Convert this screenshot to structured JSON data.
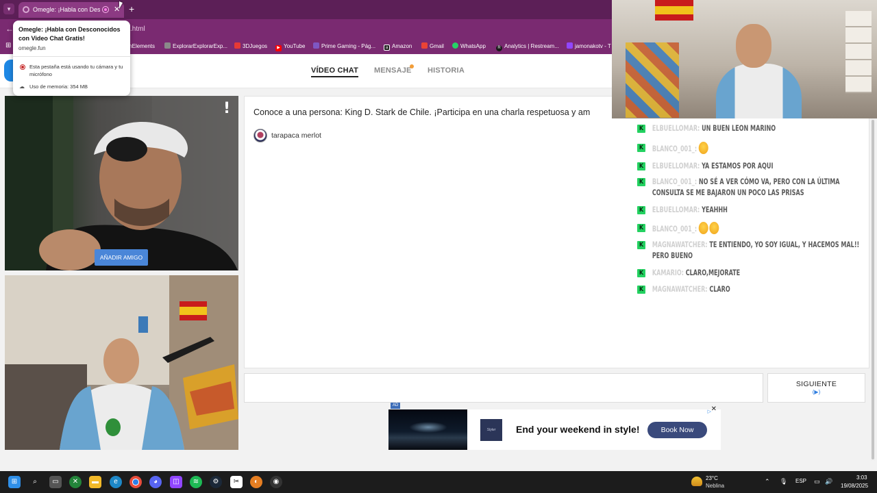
{
  "browser": {
    "tab_title": "Omegle: ¡Habla con Desconocidos con Video Chat Gratis!",
    "new_tab": "+",
    "tab_close": "✕",
    "url": ".html",
    "bookmarks": [
      {
        "label": "mElements",
        "color": "#7b6cff"
      },
      {
        "label": "ExplorarExplorarExp...",
        "color": "#8a8a8a"
      },
      {
        "label": "3DJuegos",
        "color": "#e53935"
      },
      {
        "label": "YouTube",
        "color": "#ff0000"
      },
      {
        "label": "Prime Gaming - Pág...",
        "color": "#7e57c2"
      },
      {
        "label": "Amazon",
        "color": "#222222"
      },
      {
        "label": "Gmail",
        "color": "#ea4335"
      },
      {
        "label": "WhatsApp",
        "color": "#25d366"
      },
      {
        "label": "Analytics | Restream...",
        "color": "#1a1a1a"
      },
      {
        "label": "jamonakotv - T",
        "color": "#9146ff"
      }
    ]
  },
  "hovercard": {
    "title": "Omegle: ¡Habla con Desconocidos con Video Chat Gratis!",
    "domain": "omegle.fun",
    "camera_notice": "Esta pestaña está usando tu cámara y tu micrófono",
    "memory": "Uso de memoria: 354 MB"
  },
  "nav": {
    "video_chat": "VÍDEO CHAT",
    "message": "MENSAJE",
    "history": "HISTORIA"
  },
  "video": {
    "report": "!",
    "add_friend": "AÑADIR AMIGO"
  },
  "chat": {
    "intro": "Conoce a una persona: King D. Stark de Chile. ¡Participa en una charla respetuosa y am",
    "stranger_name": "tarapaca merlot",
    "next_label": "SIGUIENTE",
    "next_icon": "(▶)"
  },
  "ad": {
    "tag": "AD",
    "headline": "End your weekend in style!",
    "cta": "Book Now",
    "close": "✕",
    "choices": "▷",
    "logo_text": "Styler"
  },
  "twitch_chat": [
    {
      "user": "ELBUELLOMAR:",
      "text": "UN BUEN LEON MARINO",
      "bar": "#3a8ee6",
      "emoji": 0
    },
    {
      "user": "BLANCO_001_:",
      "text": "",
      "bar": "#e53935",
      "emoji": 1
    },
    {
      "user": "ELBUELLOMAR:",
      "text": "YA ESTAMOS POR AQUI",
      "bar": "#3a8ee6",
      "emoji": 0
    },
    {
      "user": "BLANCO_001_:",
      "text": "NO SÉ A VER CÓMO VA, PERO CON LA ÚLTIMA CONSULTA SE ME BAJARON UN POCO LAS PRISAS",
      "bar": "#e53935",
      "emoji": 0
    },
    {
      "user": "ELBUELLOMAR:",
      "text": "YEAHHH",
      "bar": "#3a8ee6",
      "emoji": 0
    },
    {
      "user": "BLANCO_001_:",
      "text": "",
      "bar": "#e53935",
      "emoji": 2
    },
    {
      "user": "MAGNAWATCHER:",
      "text": "TE ENTIENDO, YO SOY IGUAL, Y HACEMOS MAL!! PERO BUENO",
      "bar": "#23d160",
      "emoji": 0
    },
    {
      "user": "KAMARIO:",
      "text": "CLARO,MEJORATE",
      "bar": "#f29d38",
      "emoji": 0
    },
    {
      "user": "MAGNAWATCHER:",
      "text": "CLARO",
      "bar": "#23d160",
      "emoji": 0
    }
  ],
  "taskbar": {
    "temp": "23°C",
    "condition": "Neblina",
    "lang": "ESP",
    "time": "3:03",
    "date": "19/08/2025",
    "icons": [
      "windows-icon",
      "search-icon",
      "task-view-icon",
      "xbox-icon",
      "file-explorer-icon",
      "edge-icon",
      "chrome-icon",
      "discord-icon",
      "twitch-studio-icon",
      "spotify-icon",
      "steam-icon",
      "capcut-icon",
      "firefox-icon",
      "obs-icon"
    ]
  }
}
